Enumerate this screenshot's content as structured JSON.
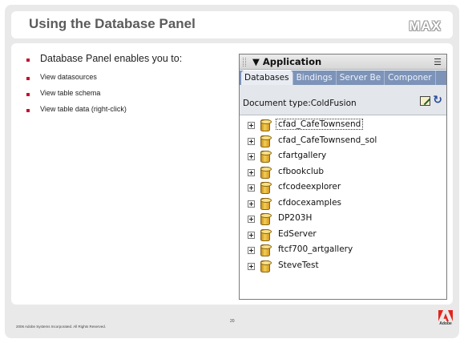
{
  "slide": {
    "title": "Using the Database Panel",
    "logo_text": "MAX",
    "bullets": [
      {
        "level": 1,
        "text": "Database Panel enables you to:"
      },
      {
        "level": 2,
        "text": "View datasources"
      },
      {
        "level": 2,
        "text": "View table schema"
      },
      {
        "level": 2,
        "text": "View table data (right-click)"
      }
    ],
    "footer": {
      "copyright": "2006 Adobe Systems Incorporated.  All Rights Reserved.",
      "page_number": "20",
      "brand": "Adobe"
    }
  },
  "panel": {
    "title": "▼ Application",
    "menu_icon": "panel-options-icon",
    "tabs": [
      {
        "label": "Databases",
        "active": true
      },
      {
        "label": "Bindings",
        "active": false
      },
      {
        "label": "Server Be",
        "active": false
      },
      {
        "label": "Componer",
        "active": false
      }
    ],
    "document_type_label": "Document type:ColdFusion",
    "datasources": [
      "cfad_CafeTownsend",
      "cfad_CafeTownsend_sol",
      "cfartgallery",
      "cfbookclub",
      "cfcodeexplorer",
      "cfdocexamples",
      "DP203H",
      "EdServer",
      "ftcf700_artgallery",
      "SteveTest"
    ],
    "selected_index": 0
  },
  "colors": {
    "accent_red": "#c8102e",
    "tab_strip": "#7d93b8"
  }
}
